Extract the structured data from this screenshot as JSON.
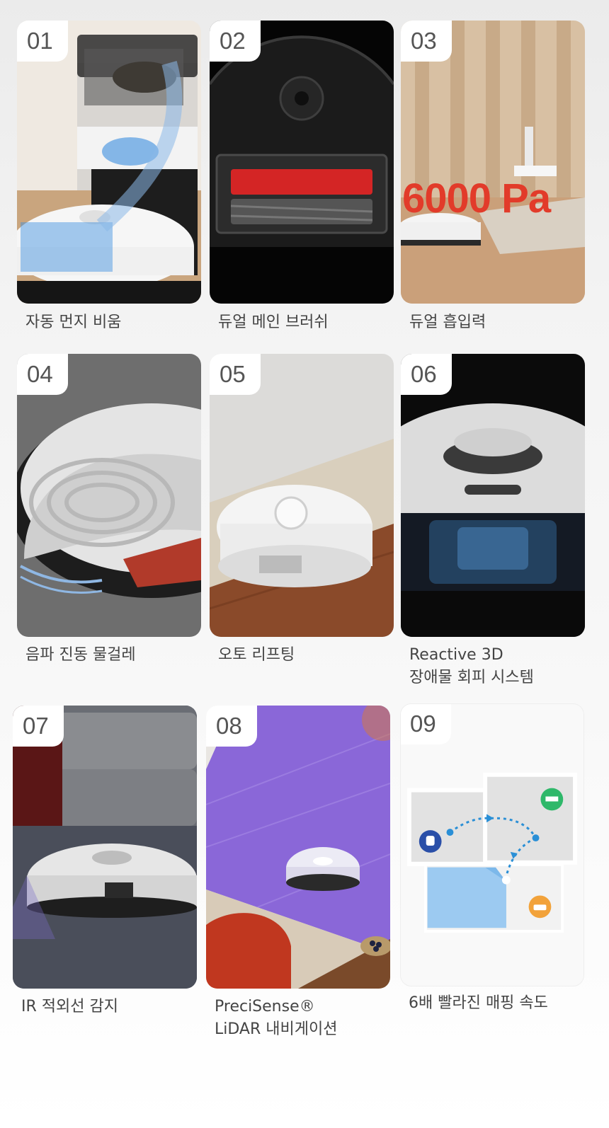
{
  "features": [
    {
      "number": "01",
      "caption": [
        "자동 먼지 비움"
      ],
      "scene": "auto-empty-dock"
    },
    {
      "number": "02",
      "caption": [
        "듀얼 메인 브러쉬"
      ],
      "scene": "dual-brush"
    },
    {
      "number": "03",
      "caption": [
        "듀얼 흡입력"
      ],
      "scene": "suction",
      "overlay_text": "6000 Pa"
    },
    {
      "number": "04",
      "caption": [
        "음파 진동 물걸레"
      ],
      "scene": "sonic-mop"
    },
    {
      "number": "05",
      "caption": [
        "오토 리프팅"
      ],
      "scene": "auto-lift"
    },
    {
      "number": "06",
      "caption": [
        "Reactive 3D",
        "장애물 회피 시스템"
      ],
      "scene": "obstacle-avoidance"
    },
    {
      "number": "07",
      "caption": [
        "IR 적외선 감지"
      ],
      "scene": "infrared"
    },
    {
      "number": "08",
      "caption": [
        "PreciSense®",
        "LiDAR 내비게이션"
      ],
      "scene": "lidar"
    },
    {
      "number": "09",
      "caption": [
        "6배 빨라진 매핑 속도"
      ],
      "scene": "mapping"
    }
  ],
  "colors": {
    "accent_red": "#e23b2a",
    "map_blue": "#2a8fd6",
    "bed_green": "#2fb86a",
    "toilet_navy": "#2a4fa8",
    "sofa_orange": "#f2a23a"
  }
}
